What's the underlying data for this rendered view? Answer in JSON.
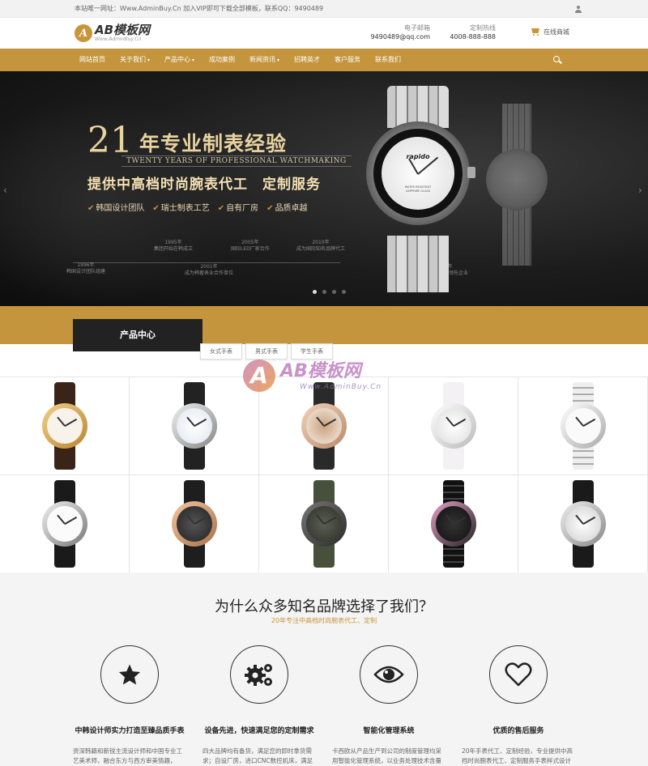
{
  "topbar": {
    "notice": "本站唯一网址：Www.AdminBuy.Cn 加入VIP即可下载全部模板，联系QQ：9490489"
  },
  "header": {
    "logo_badge": "A",
    "logo_main": "AB模板网",
    "logo_sub": "Www.AdminBuy.Cn",
    "email_label": "电子邮箱",
    "email_value": "9490489@qq.com",
    "phone_label": "定制热线",
    "phone_value": "4008-888-888",
    "cart_label": "在线商城"
  },
  "nav": {
    "items": [
      {
        "label": "网站首页",
        "has_caret": false
      },
      {
        "label": "关于我们",
        "has_caret": true
      },
      {
        "label": "产品中心",
        "has_caret": true
      },
      {
        "label": "成功案例",
        "has_caret": false
      },
      {
        "label": "新闻资讯",
        "has_caret": true
      },
      {
        "label": "招聘英才",
        "has_caret": false
      },
      {
        "label": "客户服务",
        "has_caret": false
      },
      {
        "label": "联系我们",
        "has_caret": false
      }
    ],
    "caret": "▾"
  },
  "banner": {
    "years": "21",
    "title": "年专业制表经验",
    "english": "TWENTY YEARS OF PROFESSIONAL WATCHMAKING",
    "subtitle": "提供中高档时尚腕表代工　定制服务",
    "features": [
      "韩国设计团队",
      "瑞士制表工艺",
      "自有厂房",
      "品质卓越"
    ],
    "watch_brand": "rapido",
    "watch_text": "WATER RESISTANT\nSAPPHIRE GLASS",
    "timeline": [
      {
        "year": "1995年",
        "text": "集团开始在韩成立"
      },
      {
        "year": "1996年",
        "text": "韩国设计团队组建"
      },
      {
        "year": "2001年",
        "text": "成为韩奢表业合作单位"
      },
      {
        "year": "2005年",
        "text": "国际LED厂家合作"
      },
      {
        "year": "2010年",
        "text": "成为国际知名品牌代工"
      },
      {
        "year": "2015年",
        "text": "成为专业制表领先企业"
      }
    ],
    "arrow_left": "‹",
    "arrow_right": "›",
    "active_slide": 1,
    "slide_count": 4
  },
  "products": {
    "heading": "产品中心",
    "tabs": [
      "女式手表",
      "男式手表",
      "学生手表"
    ]
  },
  "watermark": {
    "mark": "A",
    "text": "AB模板网",
    "sub": "Www.AdminBuy.Cn"
  },
  "why": {
    "title": "为什么众多知名品牌选择了我们？",
    "subtitle": "20年专注中高档时尚腕表代工、定制",
    "features": [
      {
        "icon": "star-icon",
        "title": "中韩设计师实力打造至臻品质手表",
        "desc": "资深韩籍和新锐主流设计师和中国专业工艺美术师，融合东方与西方审美情趣，"
      },
      {
        "icon": "gears-icon",
        "title": "设备先进，快速满足您的定制需求",
        "desc": "四大品牌均有备货，满足您的即时拿货需求；自设厂房，进口CNC数控机床，满足"
      },
      {
        "icon": "eye-icon",
        "title": "智能化管理系统",
        "desc": "卡西欧从产品生产到公司的制度管理均采用智能化管理系统，以业务处理技术含量"
      },
      {
        "icon": "heart-icon",
        "title": "优质的售后服务",
        "desc": "20年手表代工、定制经验，专业提供中高档时尚腕表代工、定制服务手表样式设计"
      }
    ]
  }
}
